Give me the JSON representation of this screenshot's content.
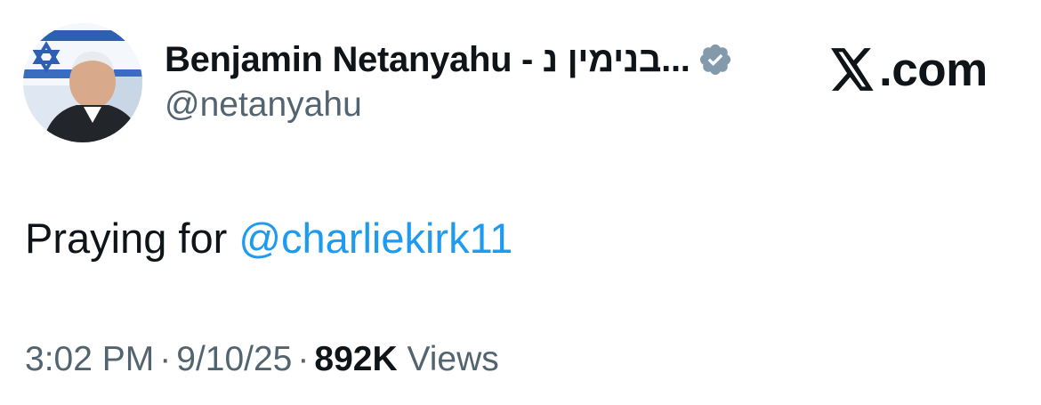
{
  "author": {
    "display_name": "Benjamin Netanyahu - בנימין נ...",
    "handle": "@netanyahu",
    "verified": true,
    "verified_color": "#829aab"
  },
  "brand": {
    "logo_icon": "x-logo-icon",
    "domain_suffix": ".com"
  },
  "tweet": {
    "text_prefix": "Praying for ",
    "mention": "@charliekirk11",
    "mention_color": "#1d9bf0"
  },
  "meta": {
    "time": "3:02 PM",
    "separator": "·",
    "date": "9/10/25",
    "views_count": "892K",
    "views_label": "Views"
  }
}
